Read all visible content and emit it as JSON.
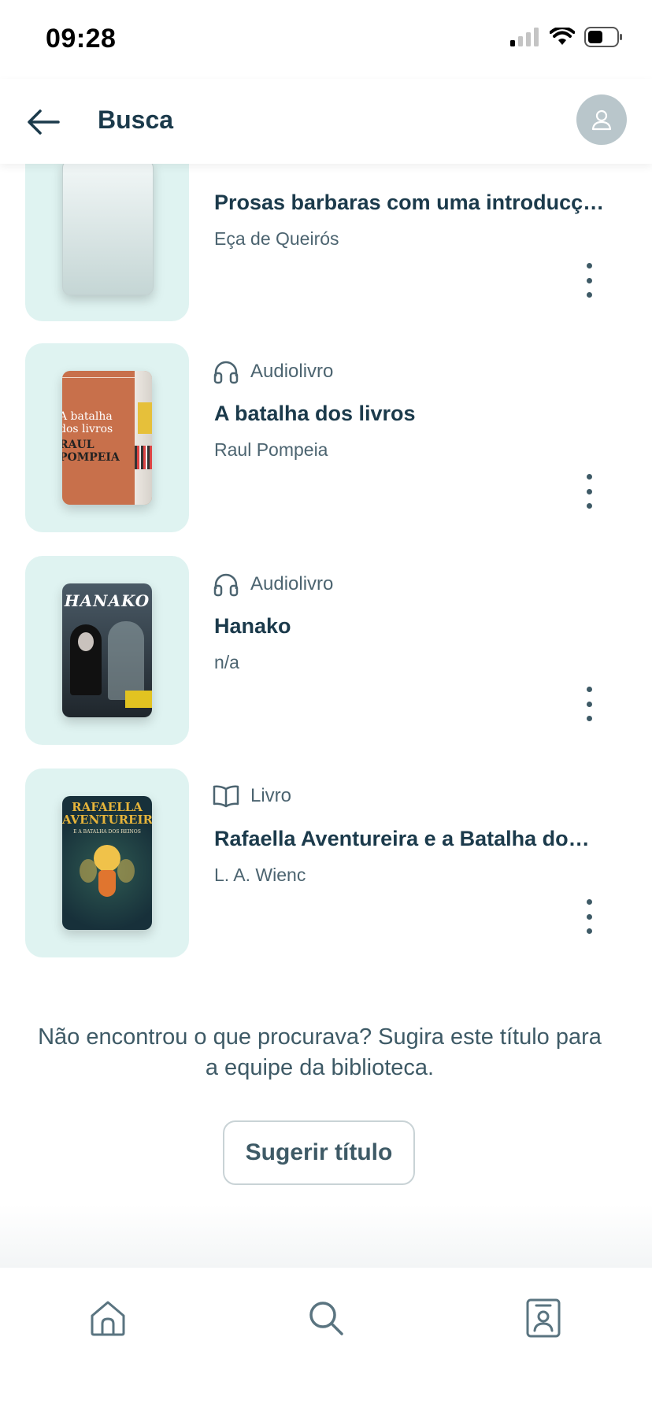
{
  "status_bar": {
    "time": "09:28",
    "icons": [
      "cellular-signal-icon",
      "wifi-icon",
      "battery-icon"
    ]
  },
  "header": {
    "title": "Busca",
    "back_icon": "arrow-left-icon",
    "avatar_icon": "user-icon"
  },
  "results": [
    {
      "format": "",
      "title": "Prosas barbaras com uma introducç…",
      "author": "Eça de Queirós",
      "format_icon": "book-icon"
    },
    {
      "format": "Audiolivro",
      "title": "A batalha dos livros",
      "author": "Raul Pompeia",
      "format_icon": "headphones-icon",
      "cover": {
        "line1": "A batalha",
        "line2": "dos livros",
        "line3": "RAUL",
        "line4": "POMPEIA"
      }
    },
    {
      "format": "Audiolivro",
      "title": "Hanako",
      "author": "n/a",
      "format_icon": "headphones-icon",
      "cover": {
        "line1": "HANAKO"
      }
    },
    {
      "format": "Livro",
      "title": "Rafaella Aventureira e a Batalha do…",
      "author": "L. A. Wienc",
      "format_icon": "book-open-icon",
      "cover": {
        "line1": "RAFAELLA",
        "line2": "AVENTUREIRA",
        "line3": "E A BATALHA DOS REINOS"
      }
    }
  ],
  "suggest": {
    "text": "Não encontrou o que procurava? Sugira este título para a equipe da biblioteca.",
    "button_label": "Sugerir título"
  },
  "bottom_nav": {
    "items": [
      {
        "icon": "home-icon"
      },
      {
        "icon": "search-icon"
      },
      {
        "icon": "library-card-icon"
      }
    ]
  },
  "colors": {
    "primary_text": "#1b3a4b",
    "secondary_text": "#4c6470",
    "cover_background": "#dff3f1",
    "avatar_background": "#b9c6cb"
  }
}
